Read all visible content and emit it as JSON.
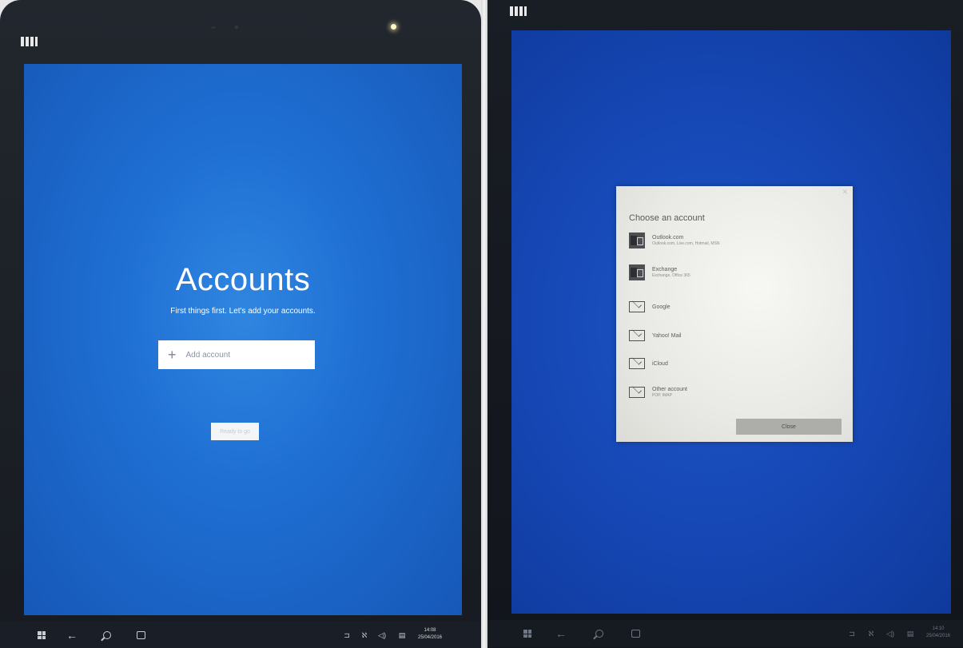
{
  "left": {
    "accounts_title": "Accounts",
    "subtitle": "First things first. Let's add your accounts.",
    "add_account_label": "Add account",
    "ready_button_label": "Ready to go",
    "clock": {
      "time": "14:08",
      "date": "25/04/2016"
    }
  },
  "right": {
    "dialog": {
      "title": "Choose an account",
      "providers": [
        {
          "name": "Outlook.com",
          "desc": "Outlook.com, Live.com, Hotmail, MSN",
          "icon": "outlook-icon"
        },
        {
          "name": "Exchange",
          "desc": "Exchange, Office 365",
          "icon": "exchange-icon"
        },
        {
          "name": "Google",
          "desc": "",
          "icon": "mail-icon"
        },
        {
          "name": "Yahoo! Mail",
          "desc": "",
          "icon": "mail-icon"
        },
        {
          "name": "iCloud",
          "desc": "",
          "icon": "mail-icon"
        },
        {
          "name": "Other account",
          "desc": "POP, IMAP",
          "icon": "mail-icon"
        }
      ],
      "close_label": "Close"
    },
    "clock": {
      "time": "14:10",
      "date": "25/04/2016"
    }
  },
  "colors": {
    "left_screen": "#1f6fd3",
    "right_screen": "#1546b3",
    "dialog_bg": "#ececE8",
    "taskbar": "#1a1f27"
  }
}
